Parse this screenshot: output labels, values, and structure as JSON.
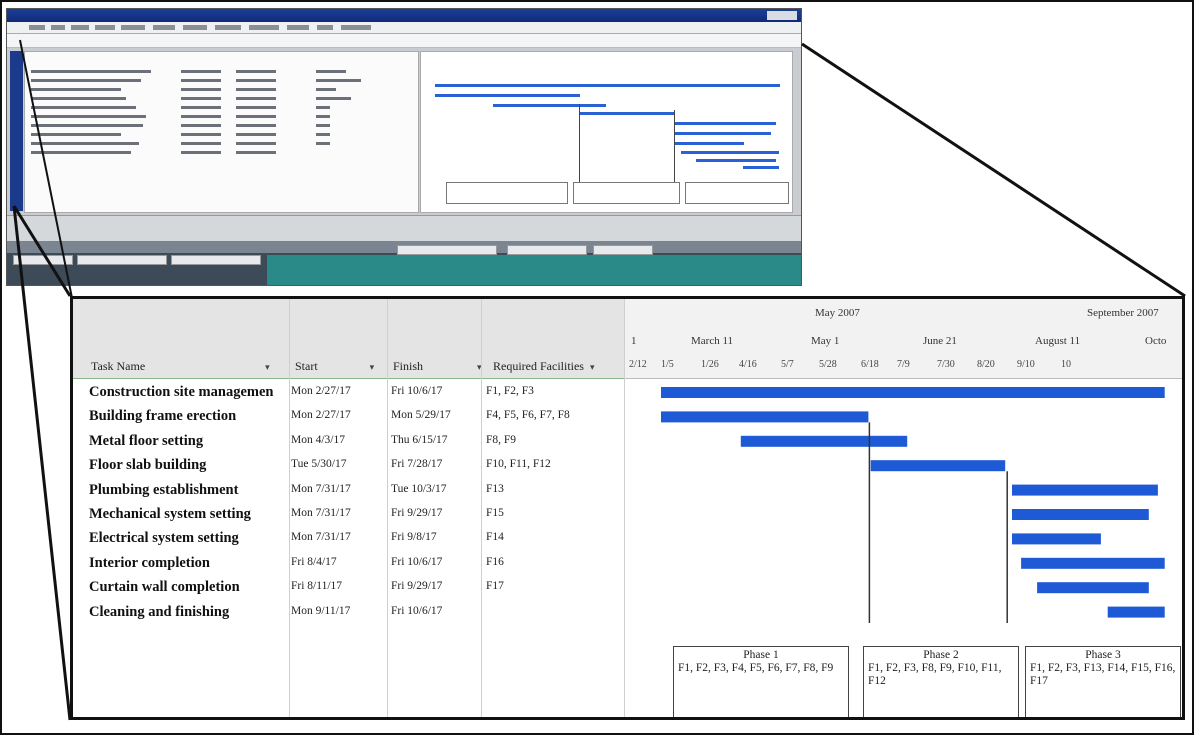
{
  "thumbnail": {
    "colors": {
      "titlebar": "#1d3f9a",
      "taskbar": "#3d4a58",
      "teal": "#2a8a88",
      "bar": "#2a62d6"
    }
  },
  "timeline": {
    "top_labels": [
      "May 2007",
      "September 2007"
    ],
    "mid_labels": [
      "1",
      "March 11",
      "May 1",
      "June 21",
      "August 11",
      "Octo"
    ],
    "week_labels": [
      "2/12",
      "1/5",
      "1/26",
      "4/16",
      "5/7",
      "5/28",
      "6/18",
      "7/9",
      "7/30",
      "8/20",
      "9/10",
      "10"
    ]
  },
  "table": {
    "headers": {
      "task_name": "Task Name",
      "start": "Start",
      "finish": "Finish",
      "facilities": "Required Facilities",
      "dropdown_glyph": "▾"
    },
    "rows": [
      {
        "name": "Construction site managemen",
        "start": "Mon 2/27/17",
        "finish": "Fri 10/6/17",
        "facilities": "F1, F2, F3"
      },
      {
        "name": "Building frame erection",
        "start": "Mon 2/27/17",
        "finish": "Mon 5/29/17",
        "facilities": "F4, F5, F6, F7, F8"
      },
      {
        "name": "Metal floor setting",
        "start": "Mon 4/3/17",
        "finish": "Thu 6/15/17",
        "facilities": "F8, F9"
      },
      {
        "name": "Floor slab building",
        "start": "Tue 5/30/17",
        "finish": "Fri 7/28/17",
        "facilities": "F10, F11, F12"
      },
      {
        "name": "Plumbing establishment",
        "start": "Mon 7/31/17",
        "finish": "Tue 10/3/17",
        "facilities": "F13"
      },
      {
        "name": "Mechanical system setting",
        "start": "Mon 7/31/17",
        "finish": "Fri 9/29/17",
        "facilities": "F15"
      },
      {
        "name": "Electrical system setting",
        "start": "Mon 7/31/17",
        "finish": "Fri 9/8/17",
        "facilities": "F14"
      },
      {
        "name": "Interior completion",
        "start": "Fri 8/4/17",
        "finish": "Fri 10/6/17",
        "facilities": "F16"
      },
      {
        "name": "Curtain wall completion",
        "start": "Fri 8/11/17",
        "finish": "Fri 9/29/17",
        "facilities": "F17"
      },
      {
        "name": "Cleaning and finishing",
        "start": "Mon 9/11/17",
        "finish": "Fri 10/6/17",
        "facilities": ""
      }
    ]
  },
  "phases": [
    {
      "title": "Phase 1",
      "text": "F1, F2, F3, F4, F5, F6, F7, F8, F9"
    },
    {
      "title": "Phase 2",
      "text": "F1, F2, F3, F8, F9, F10, F11, F12"
    },
    {
      "title": "Phase 3",
      "text": "F1, F2, F3, F13, F14, F15, F16, F17"
    }
  ],
  "colors": {
    "bar": "#1f5ad6",
    "milestone_line": "#333333",
    "grid_header": "#e4e4e4",
    "table_header_border": "#8ab88a"
  }
}
